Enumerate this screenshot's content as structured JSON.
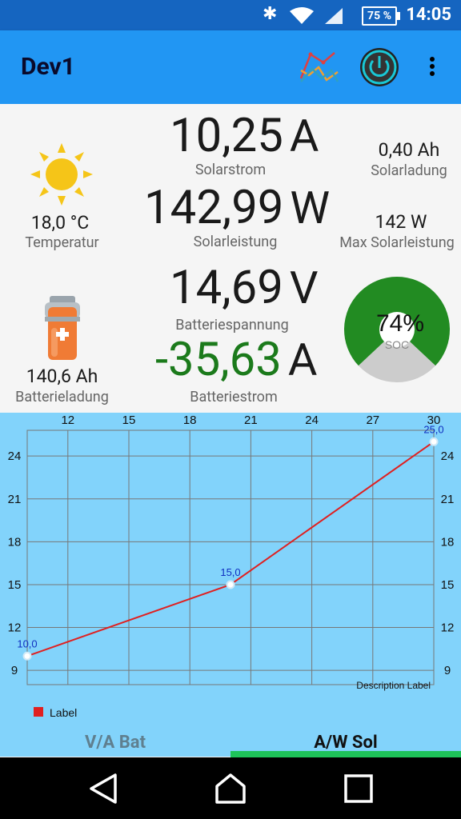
{
  "status": {
    "battery": "75 %",
    "time": "14:05"
  },
  "app": {
    "title": "Dev1"
  },
  "solar": {
    "current_value": "10,25",
    "current_unit": "A",
    "current_label": "Solarstrom",
    "power_value": "142,99",
    "power_unit": "W",
    "power_label": "Solarleistung",
    "charge_value": "0,40 Ah",
    "charge_label": "Solarladung",
    "max_power_value": "142 W",
    "max_power_label": "Max Solarleistung"
  },
  "weather": {
    "temp_value": "18,0 °C",
    "temp_label": "Temperatur"
  },
  "battery": {
    "voltage_value": "14,69",
    "voltage_unit": "V",
    "voltage_label": "Batteriespannung",
    "current_value": "-35,63",
    "current_unit": "A",
    "current_label": "Batteriestrom",
    "charge_value": "140,6 Ah",
    "charge_label": "Batterieladung",
    "soc_value": "74%",
    "soc_label": "SOC",
    "soc_fraction": 0.74,
    "current_color": "#1b7a1b"
  },
  "chart_data": {
    "type": "line",
    "x_ticks": [
      "12",
      "15",
      "18",
      "21",
      "24",
      "27",
      "30"
    ],
    "y_ticks": [
      "9",
      "12",
      "15",
      "18",
      "21",
      "24"
    ],
    "xlim": [
      10,
      30
    ],
    "ylim": [
      8,
      25.8
    ],
    "series": [
      {
        "name": "Label",
        "color": "#e02020",
        "points": [
          {
            "x": 10,
            "y": 10.0,
            "label": "10,0"
          },
          {
            "x": 20,
            "y": 15.0,
            "label": "15,0"
          },
          {
            "x": 30,
            "y": 25.0,
            "label": "25,0"
          }
        ]
      }
    ],
    "description": "Description Label",
    "grid": true,
    "legend": "bottom-left"
  },
  "tabs": [
    {
      "label": "V/A Bat",
      "active": false
    },
    {
      "label": "A/W Sol",
      "active": true
    }
  ],
  "colors": {
    "appbar": "#2196f3",
    "statusbar": "#1565c0",
    "chart_bg": "#82d3fb",
    "soc_fill": "#228b22",
    "soc_rest": "#cccccc",
    "tab_indicator": "#1ec35a"
  }
}
